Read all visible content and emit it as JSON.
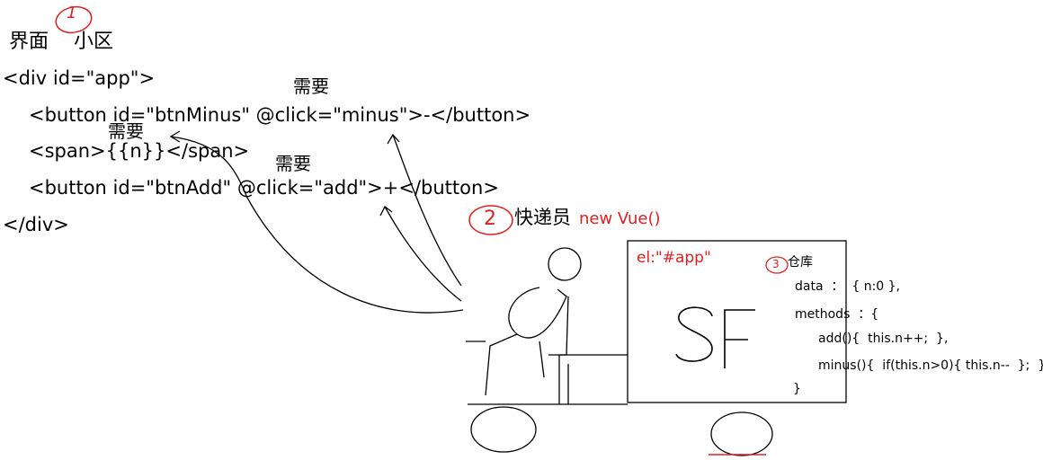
{
  "top_labels": {
    "circle_1": "1",
    "interface": "界面",
    "community": "小区"
  },
  "code_lines": [
    "<div id=\"app\">",
    "<button id=\"btnMinus\" @click=\"minus\">-</button>",
    "<span>{{n}}</span>",
    "<button id=\"btnAdd\" @click=\"add\">+</button>",
    "</div>"
  ],
  "need_labels": [
    "需要",
    "需要",
    "需要"
  ],
  "courier": {
    "circle_2": "2",
    "label": "快递员",
    "vue": "new Vue()"
  },
  "truck": {
    "el": "el:\"#app\"",
    "logo": "SF",
    "circle_3": "3",
    "warehouse": "仓库",
    "data_line": "data  ：  { n:0 },",
    "methods_line": "methods  ：{",
    "add_line": "add(){  this.n++;  },",
    "minus_line": "minus(){  if(this.n>0){ this.n--  };  }",
    "close_line": "}"
  },
  "colors": {
    "annotation_red": "#e02020",
    "ink": "#000000"
  }
}
